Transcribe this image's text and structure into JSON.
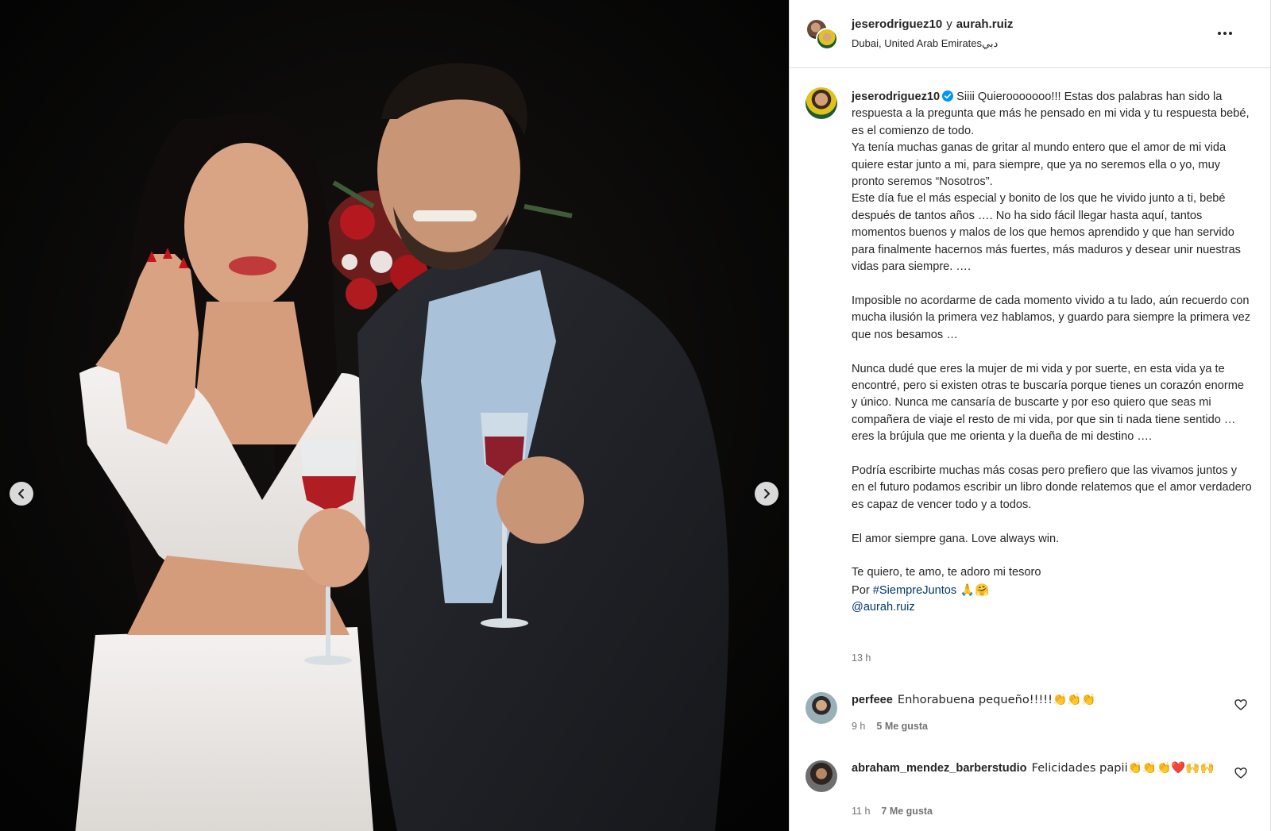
{
  "post_header": {
    "username_primary": "jeserodriguez10",
    "joiner": "y",
    "username_collab": "aurah.ruiz",
    "location": "Dubai, United Arab Emirates",
    "location_local": "دبي",
    "more_icon": "more-options-icon"
  },
  "media": {
    "prev_icon": "chevron-left-icon",
    "next_icon": "chevron-right-icon"
  },
  "caption": {
    "username": "jeserodriguez10",
    "verified_icon": "verified-badge-icon",
    "text": "Siiii Quierooooooo!!! Estas dos palabras han sido la respuesta a la pregunta que más he pensado en mi vida y tu respuesta bebé, es el comienzo de todo.\nYa tenía muchas ganas de gritar al mundo entero que el amor de mi vida quiere estar junto a mi, para siempre, que ya no seremos ella o yo, muy pronto seremos “Nosotros”.\nEste día fue el más especial y bonito de los que he vivido junto a ti, bebé después de tantos años …. No ha sido fácil llegar hasta aquí, tantos momentos buenos y malos de los que hemos aprendido y que han servido para finalmente hacernos más fuertes, más maduros y desear unir nuestras vidas para siempre. ….\n\nImposible no acordarme de cada momento vivido a tu lado, aún recuerdo con mucha ilusión la primera vez hablamos, y guardo para siempre la primera vez que nos besamos …\n\nNunca dudé que eres la mujer de mi vida y por suerte, en esta vida ya te encontré, pero si existen otras te buscaría porque tienes un corazón enorme y único. Nunca me cansaría de buscarte y por eso quiero que seas mi compañera de viaje el resto de mi vida, por que sin ti nada tiene sentido … eres la brújula que me orienta y la dueña de mi destino ….\n\nPodría escribirte muchas más cosas pero prefiero que las vivamos juntos y en el futuro podamos escribir un libro donde relatemos que el amor verdadero es capaz de vencer todo y a todos.\n\nEl amor siempre gana. Love always win.\n\nTe quiero, te amo, te adoro mi tesoro\n",
    "por_label": "Por ",
    "hashtag": "#SiempreJuntos",
    "hashtag_emojis": " 🙏🤗",
    "mention": "@aurah.ruiz",
    "time": "13 h"
  },
  "comments": [
    {
      "username": "perfeee",
      "text": "Enhorabuena pequeño!!!!!👏👏👏",
      "time": "9 h",
      "likes": "5 Me gusta",
      "heart_icon": "heart-outline-icon"
    },
    {
      "username": "abraham_mendez_barberstudio",
      "text": "Felicidades papii👏👏👏❤️🙌🙌",
      "time": "11 h",
      "likes": "7 Me gusta",
      "heart_icon": "heart-outline-icon"
    }
  ]
}
